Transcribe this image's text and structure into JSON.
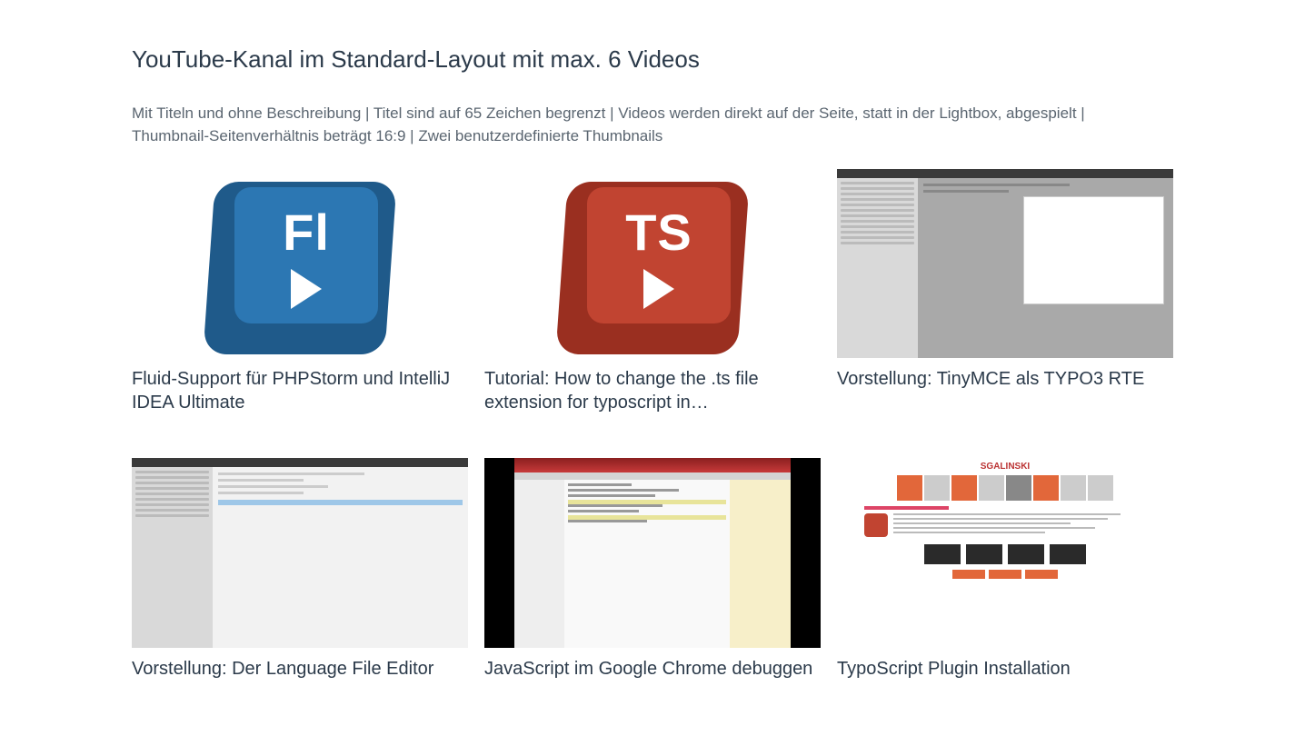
{
  "heading": "YouTube-Kanal im Standard-Layout mit max. 6 Videos",
  "subheading": "Mit Titeln und ohne Beschreibung | Titel sind auf 65 Zeichen begrenzt | Videos werden direkt auf der Seite, statt in der Lightbox, abgespielt | Thumbnail-Seitenverhältnis beträgt 16:9 | Zwei benutzerdefinierte Thumbnails",
  "videos": [
    {
      "title": "Fluid-Support für PHPStorm und IntelliJ IDEA Ultimate",
      "keycap": "Fl",
      "keycap_color": "blue"
    },
    {
      "title": "Tutorial: How to change the .ts file extension for typoscript in…",
      "keycap": "TS",
      "keycap_color": "red"
    },
    {
      "title": "Vorstellung: TinyMCE als TYPO3 RTE",
      "thumb_style": "appshot-dialog"
    },
    {
      "title": "Vorstellung: Der Language File Editor",
      "thumb_style": "appshot-form"
    },
    {
      "title": "JavaScript im Google Chrome debuggen",
      "thumb_style": "codeshot"
    },
    {
      "title": "TypoScript Plugin Installation",
      "thumb_style": "webshot",
      "brand": "SGALINSKI"
    }
  ]
}
